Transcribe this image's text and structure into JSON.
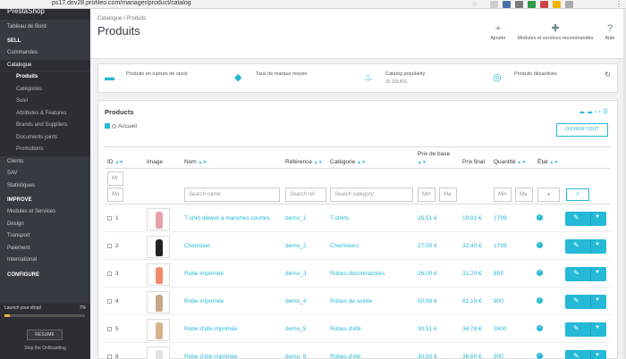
{
  "browser": {
    "url": "ps17.dev28.profileo.com/manager/product/catalog"
  },
  "sidebar": {
    "logo": "PrestaShop",
    "items": [
      {
        "label": "Tableau de Bord",
        "kind": "top"
      },
      {
        "label": "SELL",
        "kind": "head"
      },
      {
        "label": "Commandes",
        "kind": "item"
      },
      {
        "label": "Catalogue",
        "kind": "active"
      },
      {
        "label": "Produits",
        "kind": "sub-cur"
      },
      {
        "label": "Catégories",
        "kind": "sub"
      },
      {
        "label": "Suivi",
        "kind": "sub"
      },
      {
        "label": "Attributes & Features",
        "kind": "sub"
      },
      {
        "label": "Brands and Suppliers",
        "kind": "sub"
      },
      {
        "label": "Documents joints",
        "kind": "sub"
      },
      {
        "label": "Promotions",
        "kind": "sub"
      },
      {
        "label": "Clients",
        "kind": "item"
      },
      {
        "label": "SAV",
        "kind": "item"
      },
      {
        "label": "Statistiques",
        "kind": "item"
      },
      {
        "label": "IMPROVE",
        "kind": "head"
      },
      {
        "label": "Modules et Services",
        "kind": "item"
      },
      {
        "label": "Design",
        "kind": "item"
      },
      {
        "label": "Transport",
        "kind": "item"
      },
      {
        "label": "Paiement",
        "kind": "item"
      },
      {
        "label": "International",
        "kind": "item"
      },
      {
        "label": "CONFIGURE",
        "kind": "head"
      }
    ],
    "onboarding": {
      "title": "Launch your shop!",
      "percent_label": "7%",
      "progress": 0.07,
      "resume": "RESUME",
      "stop": "Stop the OnBoarding"
    }
  },
  "header": {
    "breadcrumb": "Catalogue / Produits",
    "title": "Produits",
    "toolbar": {
      "add": "Ajouter",
      "modules": "Modules et services recommandés",
      "help": "Aide"
    }
  },
  "kpi": [
    {
      "label": "Produits en rupture de stock",
      "sub": "",
      "icon": "truck-icon"
    },
    {
      "label": "Taux de marque moyen",
      "sub": "",
      "icon": "tag-icon"
    },
    {
      "label": "Catalog popularity",
      "sub": "30 JOURS",
      "icon": "flame-icon"
    },
    {
      "label": "Produits désactivés",
      "sub": "",
      "icon": "eye-slash-icon"
    }
  ],
  "panel": {
    "title": "Products",
    "tree_label": "Accueil",
    "expand_label": "OUVRIR TOUT",
    "columns": {
      "id": "ID",
      "image": "Image",
      "name": "Nom",
      "ref": "Référence",
      "cat": "Catégorie",
      "base_price_1": "Prix de",
      "base_price_2": "base",
      "final_price": "Prix final",
      "qty": "Quantité",
      "status": "État"
    },
    "filters": {
      "id_min": "Mi",
      "id_max": "Ma",
      "name": "Search name",
      "ref": "Search ref.",
      "cat": "Search category",
      "price_min": "Min",
      "price_max": "Ma",
      "qty_min": "Min",
      "qty_max": "Ma",
      "status": "▾"
    },
    "rows": [
      {
        "id": "1",
        "name": "T-shirt délavé à manches courtes",
        "ref": "demo_1",
        "cat": "T-shirts",
        "base": "16,51 €",
        "final": "19,81 €",
        "qty": "1799",
        "color": "#e8a0a8"
      },
      {
        "id": "2",
        "name": "Chemisier",
        "ref": "demo_2",
        "cat": "Chemisiers",
        "base": "27,00 €",
        "final": "32,40 €",
        "qty": "1799",
        "color": "#222222"
      },
      {
        "id": "3",
        "name": "Robe imprimée",
        "ref": "demo_3",
        "cat": "Robes décontractées",
        "base": "26,00 €",
        "final": "31,20 €",
        "qty": "899",
        "color": "#f08a6a"
      },
      {
        "id": "4",
        "name": "Robe imprimée",
        "ref": "demo_4",
        "cat": "Robes de soirée",
        "base": "50,99 €",
        "final": "61,19 €",
        "qty": "900",
        "color": "#c9a58a"
      },
      {
        "id": "5",
        "name": "Robe d'été imprimée",
        "ref": "demo_5",
        "cat": "Robes d'été",
        "base": "30,51 €",
        "final": "34,78 €",
        "qty": "3600",
        "color": "#d8b28c"
      },
      {
        "id": "6",
        "name": "Robe d'été imprimée",
        "ref": "demo_6",
        "cat": "Robes d'été",
        "base": "30,50 €",
        "final": "36,60 €",
        "qty": "900",
        "color": "#e2e2e2"
      }
    ]
  }
}
